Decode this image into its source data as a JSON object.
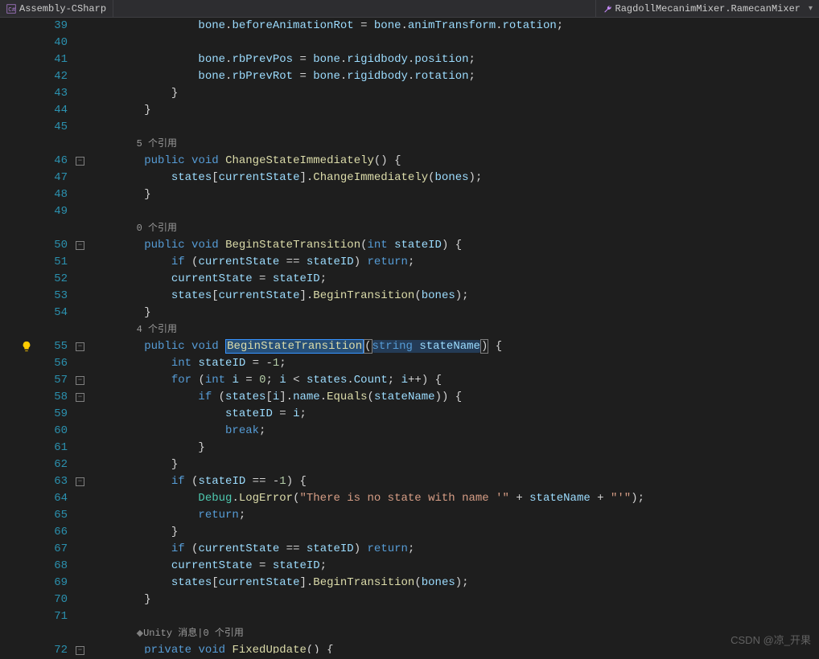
{
  "nav": {
    "left": "Assembly-CSharp",
    "right": "RagdollMecanimMixer.RamecanMixer"
  },
  "watermark": "CSDN @凉_开果",
  "codelens": {
    "r5": "5 个引用",
    "r0": "0 个引用",
    "r4": "4 个引用",
    "unity": "Unity 消息|0 个引用"
  },
  "lineNumbers": [
    "39",
    "40",
    "41",
    "42",
    "43",
    "44",
    "45",
    "",
    "46",
    "47",
    "48",
    "49",
    "",
    "50",
    "51",
    "52",
    "53",
    "54",
    "",
    "55",
    "56",
    "57",
    "58",
    "59",
    "60",
    "61",
    "62",
    "63",
    "64",
    "65",
    "66",
    "67",
    "68",
    "69",
    "70",
    "71",
    "",
    "72"
  ],
  "code": {
    "l39": "bone.beforeAnimationRot = bone.animTransform.rotation;",
    "l41a": "bone.rbPrevPos = bone.rigidbody.position;",
    "l42a": "bone.rbPrevRot = bone.rigidbody.rotation;",
    "l46": "public void ChangeStateImmediately() {",
    "l47": "states[currentState].ChangeImmediately(bones);",
    "l50": "public void BeginStateTransition(int stateID) {",
    "l51": "if (currentState == stateID) return;",
    "l52": "currentState = stateID;",
    "l53": "states[currentState].BeginTransition(bones);",
    "l55": "public void BeginStateTransition(string stateName) {",
    "l56": "int stateID = -1;",
    "l57": "for (int i = 0; i < states.Count; i++) {",
    "l58": "if (states[i].name.Equals(stateName)) {",
    "l59": "stateID = i;",
    "l60": "break;",
    "l64": "Debug.LogError(\"There is no state with name '\" + stateName + \"'\");",
    "l65": "return;",
    "l67": "if (currentState == stateID) return;",
    "l68": "currentState = stateID;",
    "l69": "states[currentState].BeginTransition(bones);",
    "l72": "private void FixedUpdate() {"
  }
}
